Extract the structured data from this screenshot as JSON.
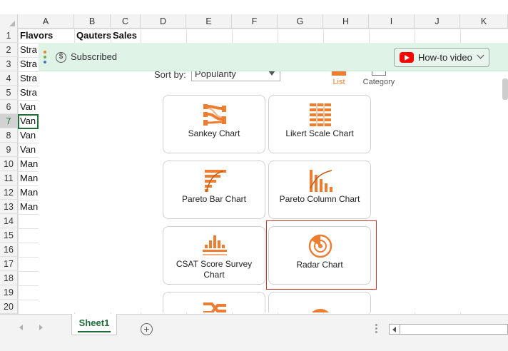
{
  "spreadsheet": {
    "columns": [
      "A",
      "B",
      "C",
      "D",
      "E",
      "F",
      "G",
      "H",
      "I",
      "J",
      "K"
    ],
    "rows": [
      "1",
      "2",
      "3",
      "4",
      "5",
      "6",
      "7",
      "8",
      "9",
      "10",
      "11",
      "12",
      "13",
      "14",
      "15",
      "16",
      "17",
      "18",
      "19",
      "20"
    ],
    "selected_row": "7",
    "header": {
      "a1": "Flavors",
      "b1": "Qauters",
      "c1": "Sales"
    },
    "col_a_values": [
      "Stra",
      "Stra",
      "Stra",
      "Stra",
      "Van",
      "Van",
      "Van",
      "Van",
      "Man",
      "Man",
      "Man",
      "Man"
    ]
  },
  "notification": {
    "status_text": "Subscribed",
    "howto_label": "How-to video",
    "accent_colors": [
      "#ed7d31",
      "#70ad47",
      "#4472c4"
    ]
  },
  "picker": {
    "sort_label": "Sort by:",
    "sort_value": "Popularity",
    "view_list_label": "List",
    "view_category_label": "Category",
    "accent": "#ed7d31",
    "cards": [
      {
        "label": "Sankey Chart",
        "icon": "sankey-chart-icon"
      },
      {
        "label": "Likert Scale Chart",
        "icon": "likert-scale-icon"
      },
      {
        "label": "Pareto Bar Chart",
        "icon": "pareto-bar-icon"
      },
      {
        "label": "Pareto Column Chart",
        "icon": "pareto-column-icon"
      },
      {
        "label": "CSAT Score Survey Chart",
        "icon": "csat-survey-icon"
      },
      {
        "label": "Radar Chart",
        "icon": "radar-chart-icon"
      }
    ]
  },
  "sheets": {
    "active": "Sheet1",
    "add_symbol": "+"
  }
}
